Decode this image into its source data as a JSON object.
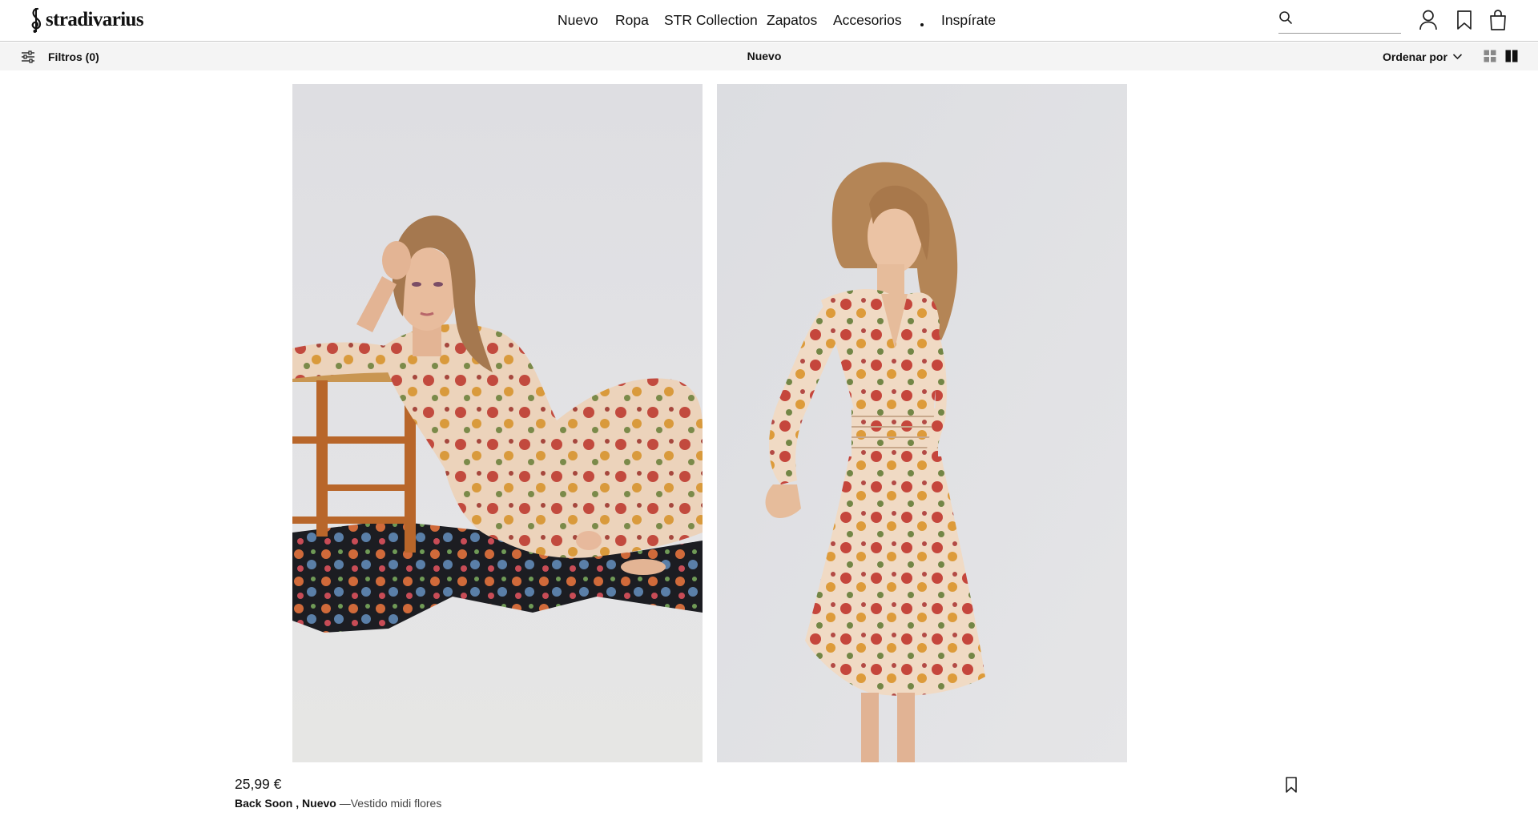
{
  "header": {
    "logo_text": "stradivarius",
    "nav": [
      "Nuevo",
      "Ropa",
      "STR Collection",
      "Zapatos",
      "Accesorios",
      "Inspírate"
    ],
    "search": {
      "placeholder": "",
      "value": ""
    },
    "icons": [
      "search-icon",
      "user-icon",
      "bookmark-icon",
      "shopping-bag-icon"
    ]
  },
  "subbar": {
    "filters_label": "Filtros (0)",
    "title": "Nuevo",
    "sort_label": "Ordenar por",
    "view_icons": [
      "grid-small-icon",
      "grid-large-icon"
    ],
    "active_view": "grid-large-icon"
  },
  "product": {
    "price": "25,99 €",
    "tag1": "Back Soon",
    "separator": ",",
    "tag2": "Nuevo",
    "dash": "—",
    "name": "Vestido midi flores",
    "images": [
      "model-seated-with-chair",
      "model-standing-side"
    ]
  },
  "colors": {
    "header_bg": "#ffffff",
    "subbar_bg": "#f4f4f4",
    "image_bg": "#e3e3e6",
    "text": "#111111"
  }
}
